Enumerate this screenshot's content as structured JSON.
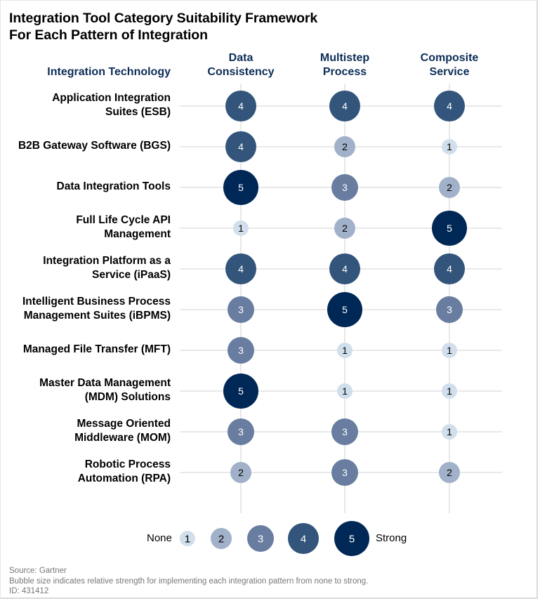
{
  "chart_data": {
    "type": "bubble-matrix",
    "title": [
      "Integration Tool Category Suitability Framework",
      "For Each Pattern of Integration"
    ],
    "row_header": "Integration Technology",
    "columns": [
      {
        "label": [
          "Data",
          "Consistency"
        ]
      },
      {
        "label": [
          "Multistep",
          "Process"
        ]
      },
      {
        "label": [
          "Composite",
          "Service"
        ]
      }
    ],
    "rows": [
      {
        "label": [
          "Application Integration",
          "Suites (ESB)"
        ],
        "values": [
          4,
          4,
          4
        ]
      },
      {
        "label": [
          "B2B Gateway Software (BGS)"
        ],
        "values": [
          4,
          2,
          1
        ]
      },
      {
        "label": [
          "Data Integration Tools"
        ],
        "values": [
          5,
          3,
          2
        ]
      },
      {
        "label": [
          "Full Life Cycle API",
          "Management"
        ],
        "values": [
          1,
          2,
          5
        ]
      },
      {
        "label": [
          "Integration Platform as a",
          "Service (iPaaS)"
        ],
        "values": [
          4,
          4,
          4
        ]
      },
      {
        "label": [
          "Intelligent Business Process",
          "Management Suites (iBPMS)"
        ],
        "values": [
          3,
          5,
          3
        ]
      },
      {
        "label": [
          "Managed File Transfer (MFT)"
        ],
        "values": [
          3,
          1,
          1
        ]
      },
      {
        "label": [
          "Master Data Management",
          "(MDM) Solutions"
        ],
        "values": [
          5,
          1,
          1
        ]
      },
      {
        "label": [
          "Message Oriented",
          "Middleware (MOM)"
        ],
        "values": [
          3,
          3,
          1
        ]
      },
      {
        "label": [
          "Robotic Process",
          "Automation (RPA)"
        ],
        "values": [
          2,
          3,
          2
        ]
      }
    ],
    "scale": {
      "min": 1,
      "max": 5,
      "min_label": "None",
      "max_label": "Strong"
    },
    "legend": {
      "levels": [
        1,
        2,
        3,
        4,
        5
      ],
      "left_label": "None",
      "right_label": "Strong",
      "placement": "bottom"
    },
    "colors": {
      "1": "#d0dfeb",
      "2": "#a0b1c9",
      "3": "#687d9f",
      "4": "#33557b",
      "5": "#002856"
    },
    "label_colors": {
      "1": "#000000",
      "2": "#000000",
      "3": "#ffffff",
      "4": "#ffffff",
      "5": "#ffffff"
    },
    "grid": true
  },
  "footer": {
    "source": "Source: Gartner",
    "note": "Bubble size indicates relative strength for implementing each integration pattern from none to strong.",
    "id": "ID: 431412"
  }
}
